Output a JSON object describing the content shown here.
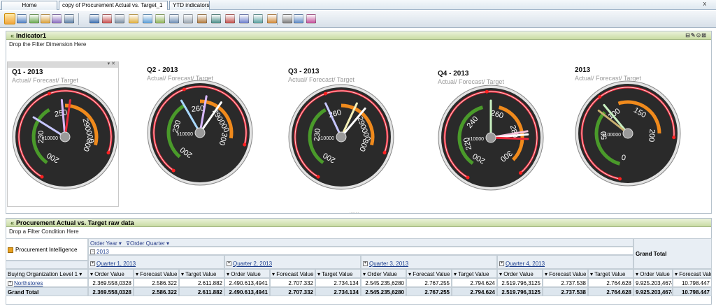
{
  "tabs": [
    {
      "label": "Home",
      "active": false
    },
    {
      "label": "copy of Procurement Actual vs. Target_1",
      "active": true
    },
    {
      "label": "YTD indicators",
      "active": false
    }
  ],
  "window_close": "x",
  "indicator_panel": {
    "title": "Indicator1",
    "drop_hint": "Drop the Filter Dimension Here",
    "controls": "⊟✎⊙⊠",
    "splitter": "........",
    "gauges": [
      {
        "title": "Q1 - 2013",
        "subtitle": "Actual/ Forecast/ Target",
        "multiplier": "x10000",
        "ticks": [
          "200",
          "230",
          "250",
          "290000",
          "300"
        ]
      },
      {
        "title": "Q2 - 2013",
        "subtitle": "Actual/ Forecast/ Target",
        "multiplier": "x10000",
        "ticks": [
          "200",
          "230",
          "260",
          "290000",
          "300"
        ]
      },
      {
        "title": "Q3 - 2013",
        "subtitle": "Actual/ Forecast/ Target",
        "multiplier": "x10000",
        "ticks": [
          "200",
          "230",
          "260",
          "290000",
          "300"
        ]
      },
      {
        "title": "Q4 - 2013",
        "subtitle": "Actual/ Forecast/ Target",
        "multiplier": "x10000",
        "ticks": [
          "200",
          "220",
          "240",
          "260",
          "280",
          "300"
        ]
      },
      {
        "title": "2013",
        "subtitle": "Actual/ Forecast/ Target",
        "multiplier": "x100000",
        "ticks": [
          "0",
          "50",
          "100",
          "150",
          "200"
        ]
      }
    ]
  },
  "table_panel": {
    "title": "Procurement Actual vs. Target raw data",
    "drop_hint": "Drop a Filter Condition Here",
    "cube_label": "Procurement Intelligence",
    "col_dims": [
      "Order Year",
      "Order Quarter"
    ],
    "year": "2013",
    "grand_total_header": "Grand Total",
    "quarters": [
      "Quarter 1, 2013",
      "Quarter 2, 2013",
      "Quarter 3, 2013",
      "Quarter 4, 2013"
    ],
    "row_dim": "Buying Organization Level 1",
    "measures": [
      "Order Value",
      "Forecast Value",
      "Target Value"
    ],
    "rows": [
      {
        "label": "Northstores",
        "values": [
          "2.369.558,0328",
          "2.586.322",
          "2.611.882",
          "2.490.613,4941",
          "2.707.332",
          "2.734.134",
          "2.545.235,6280",
          "2.767.255",
          "2.794.624",
          "2.519.796,3125",
          "2.737.538",
          "2.764.628",
          "9.925.203,4674",
          "10.798.447"
        ]
      },
      {
        "label": "Grand Total",
        "values": [
          "2.369.558,0328",
          "2.586.322",
          "2.611.882",
          "2.490.613,4941",
          "2.707.332",
          "2.734.134",
          "2.545.235,6280",
          "2.767.255",
          "2.794.624",
          "2.519.796,3125",
          "2.737.538",
          "2.764.628",
          "9.925.203,4674",
          "10.798.447"
        ]
      }
    ]
  },
  "colors": {
    "gauge_bg": "#2a2a2a",
    "accent_green": "#c9dca4",
    "target_red": "#e8283a",
    "band_green": "#4a9a2a",
    "band_orange": "#f08a1c"
  }
}
